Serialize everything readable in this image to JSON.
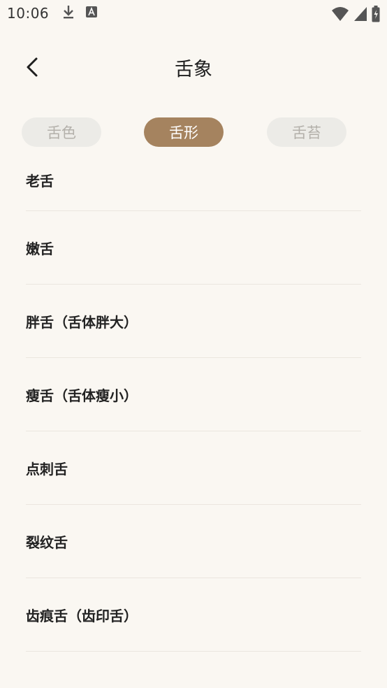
{
  "status_bar": {
    "time": "10:06",
    "icons_left": [
      "download-icon",
      "text-a-icon"
    ],
    "icons_right": [
      "wifi-icon",
      "signal-icon",
      "battery-icon"
    ]
  },
  "header": {
    "title": "舌象",
    "back_icon": "chevron-left-icon"
  },
  "tabs": [
    {
      "label": "舌色",
      "active": false
    },
    {
      "label": "舌形",
      "active": true
    },
    {
      "label": "舌苔",
      "active": false
    }
  ],
  "list": [
    {
      "label": "老舌"
    },
    {
      "label": "嫩舌"
    },
    {
      "label": "胖舌（舌体胖大）"
    },
    {
      "label": "瘦舌（舌体瘦小）"
    },
    {
      "label": "点刺舌"
    },
    {
      "label": "裂纹舌"
    },
    {
      "label": "齿痕舌（齿印舌）"
    }
  ],
  "colors": {
    "background": "#faf7f2",
    "accent": "#a5835f",
    "tab_inactive_bg": "#ecebe7",
    "tab_inactive_text": "#b3b0aa"
  }
}
